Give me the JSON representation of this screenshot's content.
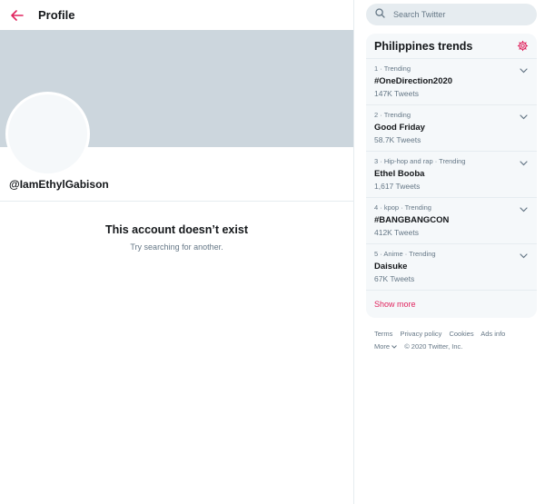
{
  "header": {
    "title": "Profile"
  },
  "profile": {
    "handle": "@IamEthylGabison"
  },
  "empty_state": {
    "title": "This account doesn’t exist",
    "subtitle": "Try searching for another."
  },
  "search": {
    "placeholder": "Search Twitter"
  },
  "trends": {
    "title": "Philippines trends",
    "items": [
      {
        "meta": "1 · Trending",
        "name": "#OneDirection2020",
        "count": "147K Tweets"
      },
      {
        "meta": "2 · Trending",
        "name": "Good Friday",
        "count": "58.7K Tweets"
      },
      {
        "meta": "3 · Hip-hop and rap · Trending",
        "name": "Ethel Booba",
        "count": "1,617 Tweets"
      },
      {
        "meta": "4 · kpop · Trending",
        "name": "#BANGBANGCON",
        "count": "412K Tweets"
      },
      {
        "meta": "5 · Anime · Trending",
        "name": "Daisuke",
        "count": "67K Tweets"
      }
    ],
    "show_more": "Show more"
  },
  "footer": {
    "terms": "Terms",
    "privacy": "Privacy policy",
    "cookies": "Cookies",
    "ads": "Ads info",
    "more": "More",
    "copyright": "© 2020 Twitter, Inc."
  },
  "colors": {
    "accent": "#e0245e",
    "banner": "#ccd6dd",
    "muted": "#657786"
  }
}
